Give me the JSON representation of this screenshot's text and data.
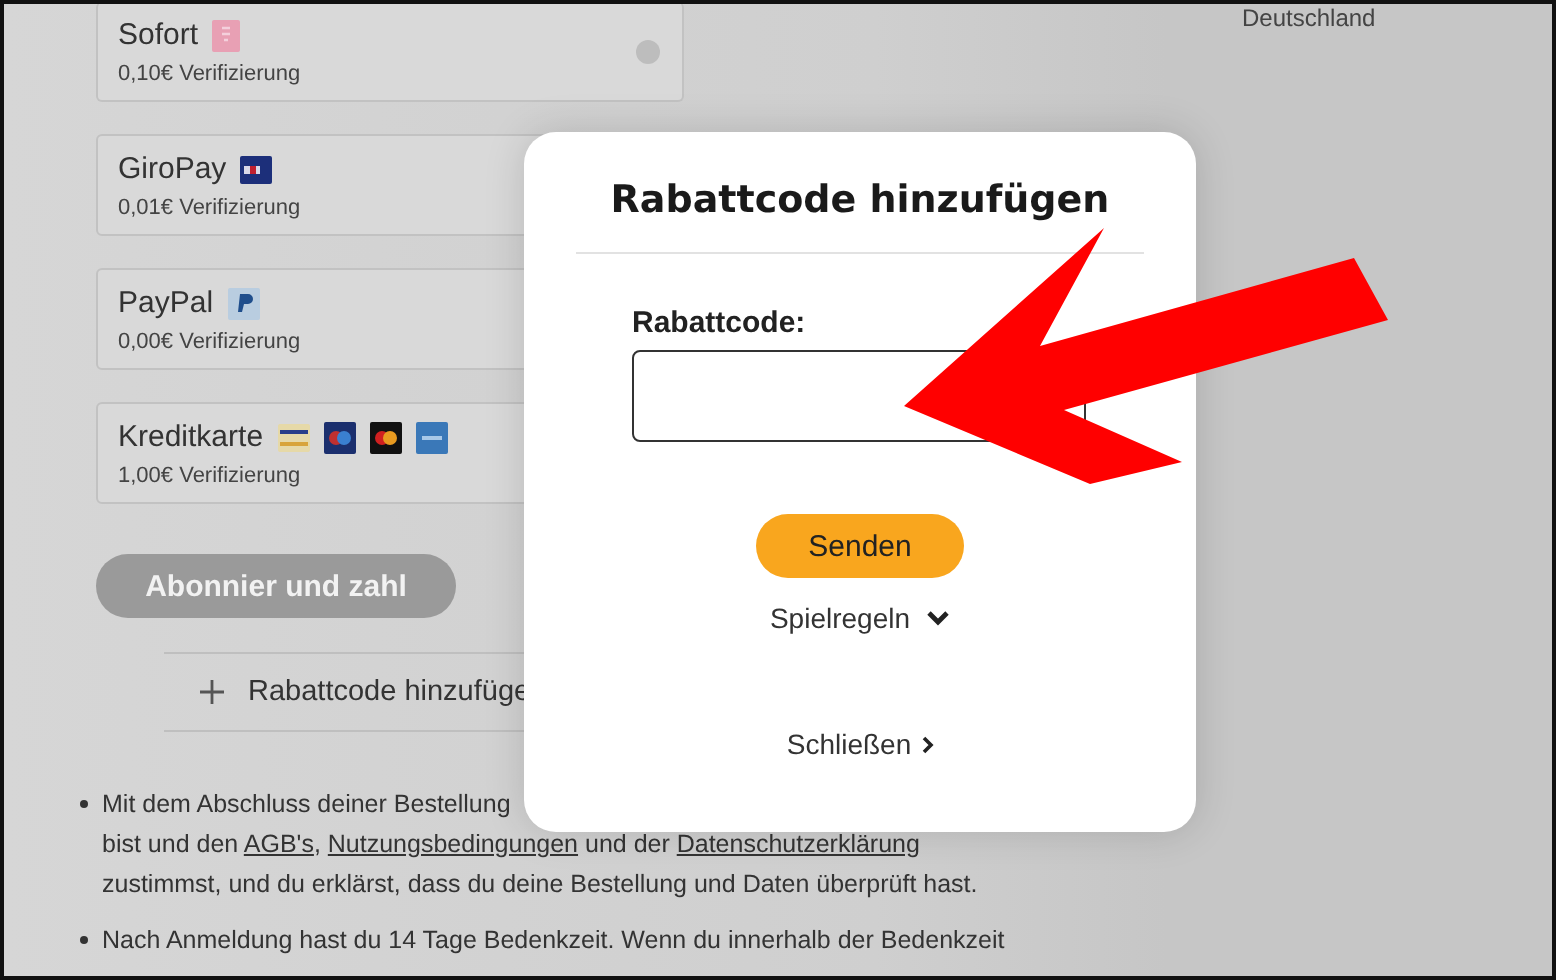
{
  "sidebar": {
    "text": "Deutschland"
  },
  "payment_methods": [
    {
      "name": "Sofort",
      "fee": "0,10€ Verifizierung",
      "logos": [
        {
          "kind": "sofort"
        }
      ],
      "radio": {
        "selected": false
      }
    },
    {
      "name": "GiroPay",
      "fee": "0,01€ Verifizierung",
      "logos": [
        {
          "kind": "giropay"
        }
      ]
    },
    {
      "name": "PayPal",
      "fee": "0,00€ Verifizierung",
      "logos": [
        {
          "kind": "paypal"
        }
      ]
    },
    {
      "name": "Kreditkarte",
      "fee": "1,00€ Verifizierung",
      "logos": [
        {
          "kind": "visa"
        },
        {
          "kind": "maestro"
        },
        {
          "kind": "mastercard"
        },
        {
          "kind": "amex"
        }
      ]
    }
  ],
  "subscribe_button": {
    "label": "Abonnier und zahl",
    "disabled": true
  },
  "discount_row": {
    "label": "Rabattcode hinzufüge"
  },
  "terms": [
    {
      "lines": [
        [
          {
            "text": "Mit dem Abschluss deiner Bestellung"
          }
        ],
        [
          {
            "text": "bist und den "
          },
          {
            "text": "AGB's",
            "link": true
          },
          {
            "text": ", "
          },
          {
            "text": "Nutzungsbedingungen",
            "link": true
          },
          {
            "text": " und der "
          },
          {
            "text": "Datenschutzerklärung",
            "link": true
          }
        ],
        [
          {
            "text": "zustimmst, und du erklärst, dass du deine Bestellung und Daten überprüft hast."
          }
        ]
      ]
    },
    {
      "lines": [
        [
          {
            "text": "Nach Anmeldung hast du 14 Tage Bedenkzeit. Wenn du innerhalb der Bedenkzeit"
          }
        ]
      ]
    }
  ],
  "modal": {
    "title": "Rabattcode hinzufügen",
    "field_label": "Rabattcode:",
    "submit_button": "Senden",
    "rules_toggle": {
      "label": "Spielregeln",
      "expanded": false
    },
    "close_link": "Schließen"
  }
}
